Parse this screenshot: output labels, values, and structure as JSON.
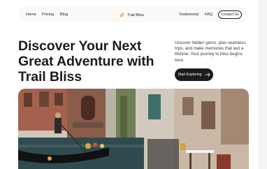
{
  "nav": {
    "links_left": [
      "Home",
      "Pricing",
      "Blog"
    ],
    "brand": "Trail Bliss",
    "brand_icon": "leaf-logo-icon",
    "links_right": [
      "Testimonial",
      "FAQ"
    ],
    "contact_label": "Contact Us"
  },
  "hero": {
    "title": "Discover Your Next Great Adventure with Trail Bliss",
    "description": "Uncover hidden gems, plan seamless trips, and make memories that last a lifetime. Your journey to bliss begins here.",
    "cta_label": "Start Exploring",
    "cta_icon": "arrow-right-icon"
  },
  "colors": {
    "accent": "#1c1c1c",
    "brand_logo": "#f2a23a",
    "nav_background": "#faf9f6"
  }
}
